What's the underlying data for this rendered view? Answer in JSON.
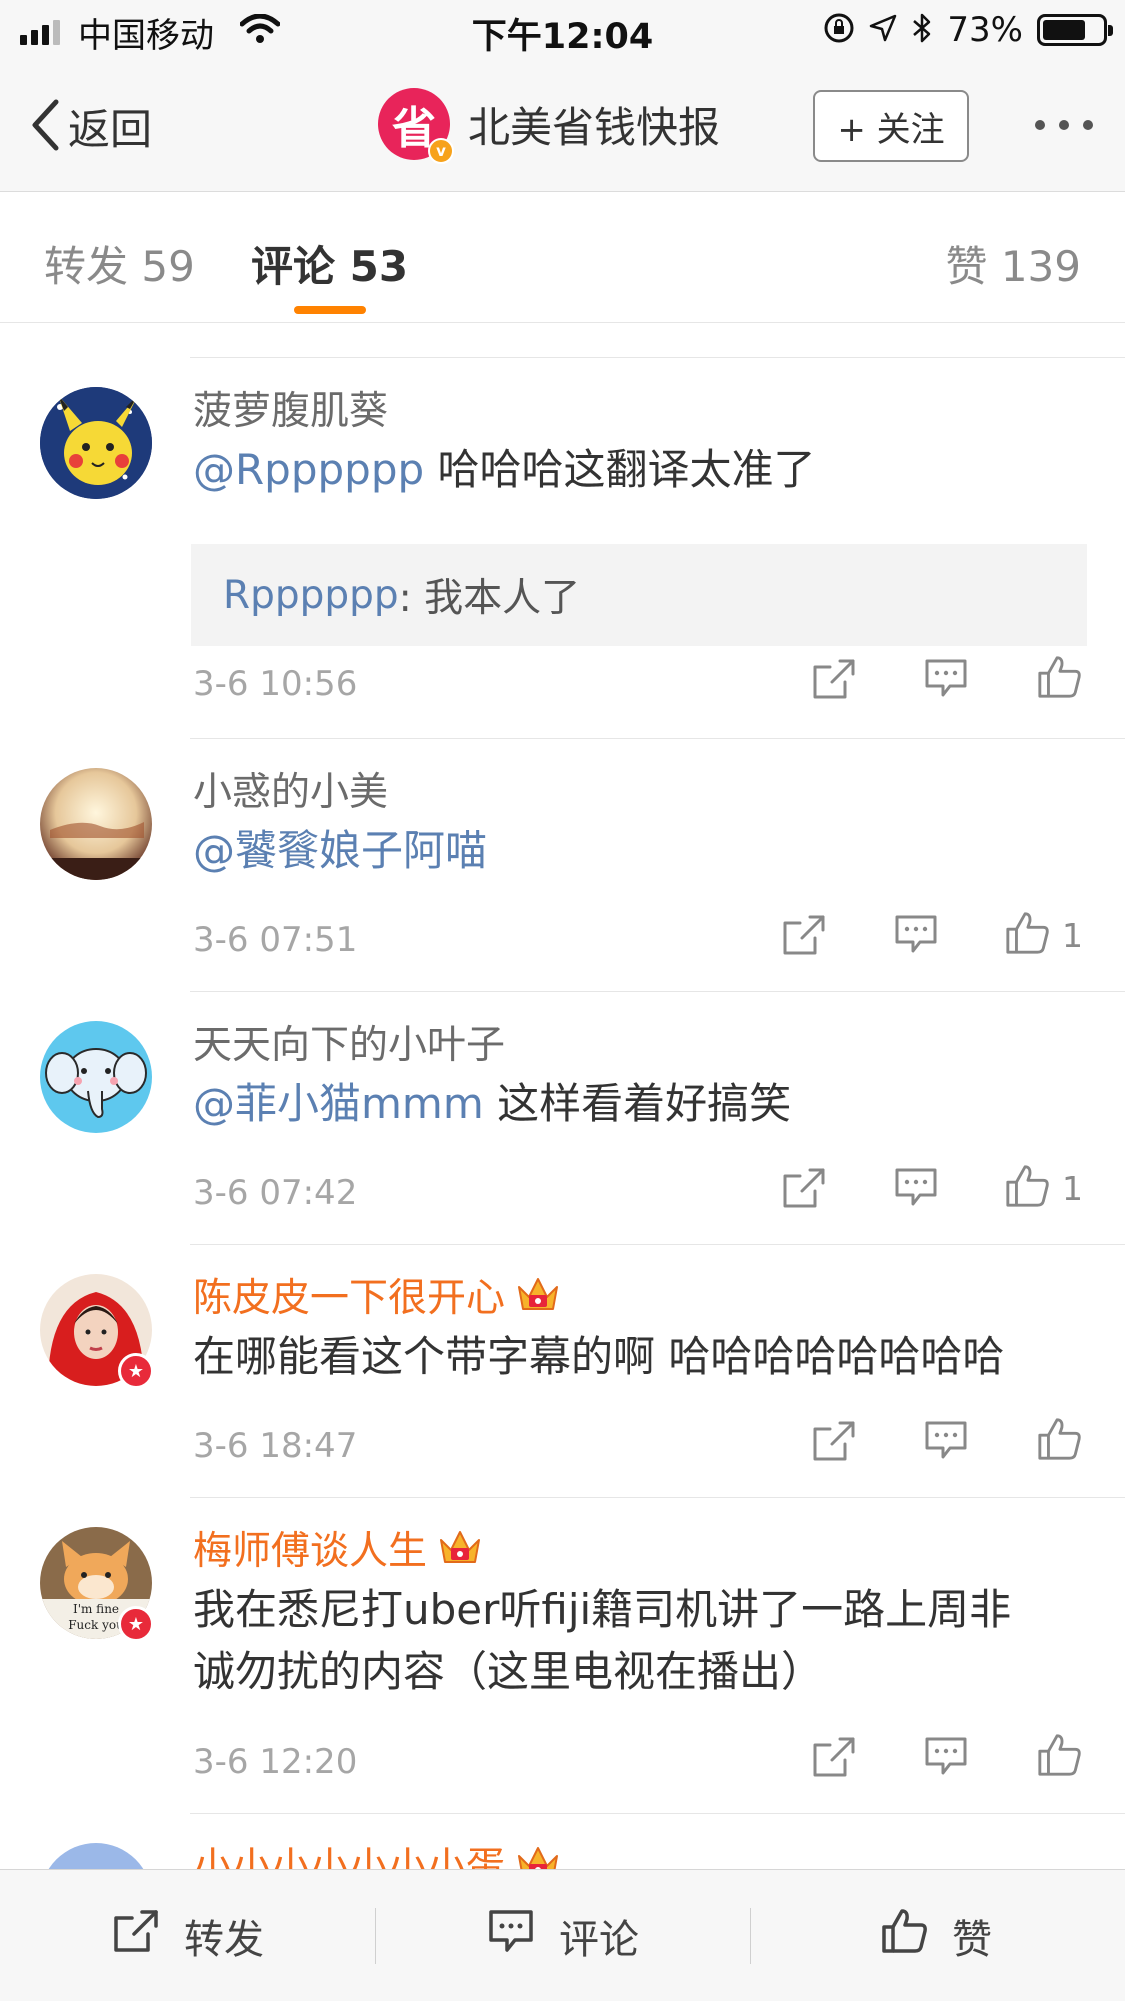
{
  "status_bar": {
    "carrier": "中国移动",
    "time": "下午12:04",
    "battery": "73%",
    "battery_level": 0.73
  },
  "nav": {
    "back_label": "返回",
    "avatar_char": "省",
    "title": "北美省钱快报",
    "follow_label": "+ 关注"
  },
  "tabs": {
    "repost": "转发 59",
    "comments": "评论 53",
    "likes": "赞 139"
  },
  "comments": [
    {
      "name": "菠萝腹肌葵",
      "mention": "@Rpppppp",
      "text": " 哈哈哈这翻译太准了",
      "quote_name": "Rpppppp",
      "quote_text": ": 我本人了",
      "time": "3-6 10:56",
      "likes": ""
    },
    {
      "name": "小惑的小美",
      "mention": "@饕餮娘子阿喵",
      "text": "",
      "time": "3-6 07:51",
      "likes": "1"
    },
    {
      "name": "天天向下的小叶子",
      "mention": "@菲小猫mmm",
      "text": " 这样看着好搞笑",
      "time": "3-6 07:42",
      "likes": "1"
    },
    {
      "name": "陈皮皮一下很开心",
      "text": "在哪能看这个带字幕的啊 哈哈哈哈哈哈哈哈",
      "time": "3-6 18:47",
      "likes": ""
    },
    {
      "name": "梅师傅谈人生",
      "text_line1": "我在悉尼打uber听fiji籍司机讲了一路上周非",
      "text_line2": "诚勿扰的内容（这里电视在播出）",
      "avatar_text": "I'm fine Fuck you",
      "time": "3-6 12:20",
      "likes": ""
    },
    {
      "name": "小小小小小小小蛋"
    }
  ],
  "bottom_bar": {
    "repost": "转发",
    "comment": "评论",
    "like": "赞"
  },
  "colors": {
    "accent": "#ff8200",
    "link": "#5b80b2",
    "vip_name": "#f26f1f",
    "brand": "#e8245a"
  }
}
